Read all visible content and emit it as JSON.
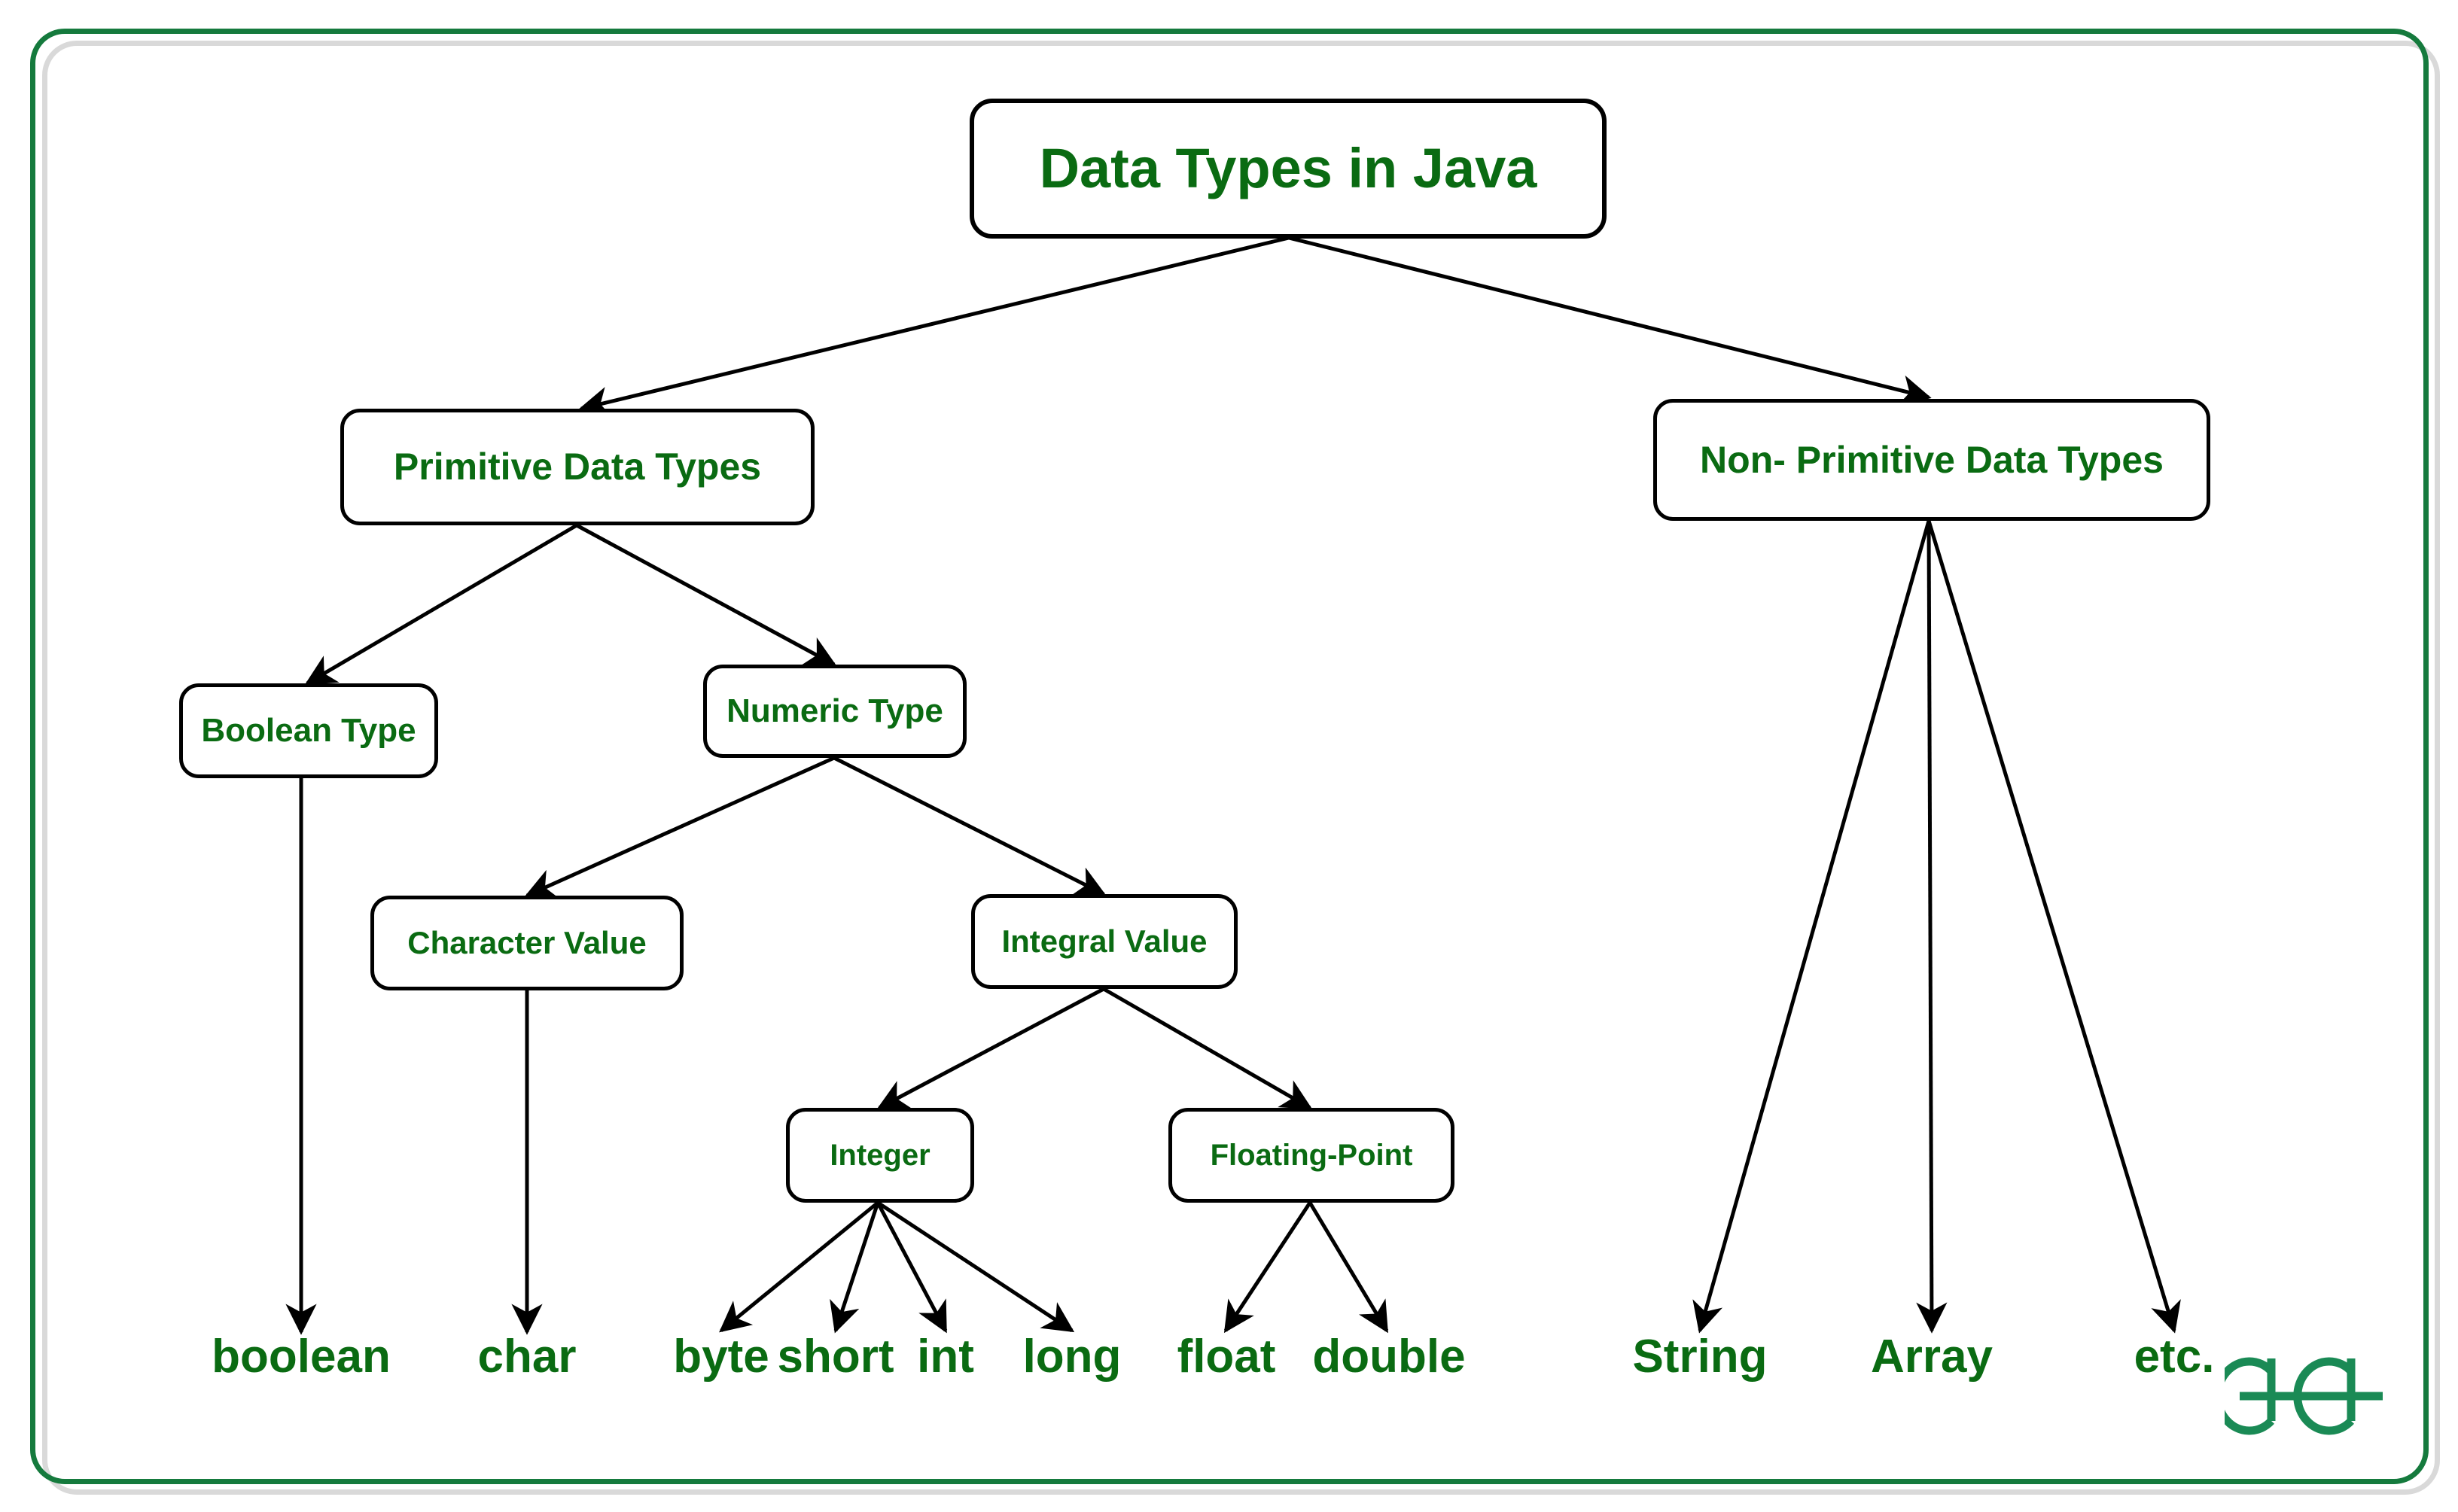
{
  "diagram": {
    "title": "Data Types in Java",
    "accent_green": "#0a6b12",
    "frame_green": "#157a3d",
    "frame_shadow_grey": "#d9d9d9",
    "edge_color": "#000000",
    "nodes": {
      "root": "Data Types in Java",
      "primitive": "Primitive Data Types",
      "non_primitive": "Non- Primitive Data Types",
      "boolean_type": "Boolean Type",
      "numeric_type": "Numeric Type",
      "character_value": "Character Value",
      "integral_value": "Integral Value",
      "integer": "Integer",
      "floating_point": "Floating-Point"
    },
    "leaves": {
      "boolean": "boolean",
      "char": "char",
      "byte": "byte",
      "short": "short",
      "int": "int",
      "long": "long",
      "float": "float",
      "double": "double",
      "string": "String",
      "array": "Array",
      "etc": "etc."
    },
    "logo": {
      "name": "GeeksforGeeks",
      "color": "#1a8a55"
    }
  },
  "chart_data": {
    "type": "tree-diagram",
    "title": "Data Types in Java",
    "nodes": [
      {
        "id": "root",
        "label": "Data Types in Java",
        "level": 0,
        "shape": "rounded-box"
      },
      {
        "id": "primitive",
        "label": "Primitive Data Types",
        "level": 1,
        "shape": "rounded-box"
      },
      {
        "id": "non_primitive",
        "label": "Non- Primitive Data Types",
        "level": 1,
        "shape": "rounded-box"
      },
      {
        "id": "boolean_type",
        "label": "Boolean Type",
        "level": 2,
        "shape": "rounded-box"
      },
      {
        "id": "numeric_type",
        "label": "Numeric Type",
        "level": 2,
        "shape": "rounded-box"
      },
      {
        "id": "character_value",
        "label": "Character Value",
        "level": 3,
        "shape": "rounded-box"
      },
      {
        "id": "integral_value",
        "label": "Integral Value",
        "level": 3,
        "shape": "rounded-box"
      },
      {
        "id": "integer",
        "label": "Integer",
        "level": 4,
        "shape": "rounded-box"
      },
      {
        "id": "floating_point",
        "label": "Floating-Point",
        "level": 4,
        "shape": "rounded-box"
      },
      {
        "id": "boolean",
        "label": "boolean",
        "level": 5,
        "shape": "text"
      },
      {
        "id": "char",
        "label": "char",
        "level": 5,
        "shape": "text"
      },
      {
        "id": "byte",
        "label": "byte",
        "level": 5,
        "shape": "text"
      },
      {
        "id": "short",
        "label": "short",
        "level": 5,
        "shape": "text"
      },
      {
        "id": "int",
        "label": "int",
        "level": 5,
        "shape": "text"
      },
      {
        "id": "long",
        "label": "long",
        "level": 5,
        "shape": "text"
      },
      {
        "id": "float",
        "label": "float",
        "level": 5,
        "shape": "text"
      },
      {
        "id": "double",
        "label": "double",
        "level": 5,
        "shape": "text"
      },
      {
        "id": "string",
        "label": "String",
        "level": 2,
        "shape": "text"
      },
      {
        "id": "array",
        "label": "Array",
        "level": 2,
        "shape": "text"
      },
      {
        "id": "etc",
        "label": "etc.",
        "level": 2,
        "shape": "text"
      }
    ],
    "edges": [
      {
        "from": "root",
        "to": "primitive"
      },
      {
        "from": "root",
        "to": "non_primitive"
      },
      {
        "from": "primitive",
        "to": "boolean_type"
      },
      {
        "from": "primitive",
        "to": "numeric_type"
      },
      {
        "from": "boolean_type",
        "to": "boolean"
      },
      {
        "from": "numeric_type",
        "to": "character_value"
      },
      {
        "from": "numeric_type",
        "to": "integral_value"
      },
      {
        "from": "character_value",
        "to": "char"
      },
      {
        "from": "integral_value",
        "to": "integer"
      },
      {
        "from": "integral_value",
        "to": "floating_point"
      },
      {
        "from": "integer",
        "to": "byte"
      },
      {
        "from": "integer",
        "to": "short"
      },
      {
        "from": "integer",
        "to": "int"
      },
      {
        "from": "integer",
        "to": "long"
      },
      {
        "from": "floating_point",
        "to": "float"
      },
      {
        "from": "floating_point",
        "to": "double"
      },
      {
        "from": "non_primitive",
        "to": "string"
      },
      {
        "from": "non_primitive",
        "to": "array"
      },
      {
        "from": "non_primitive",
        "to": "etc"
      }
    ],
    "edge_style": "straight-arrow",
    "legend": [],
    "grid": false
  }
}
